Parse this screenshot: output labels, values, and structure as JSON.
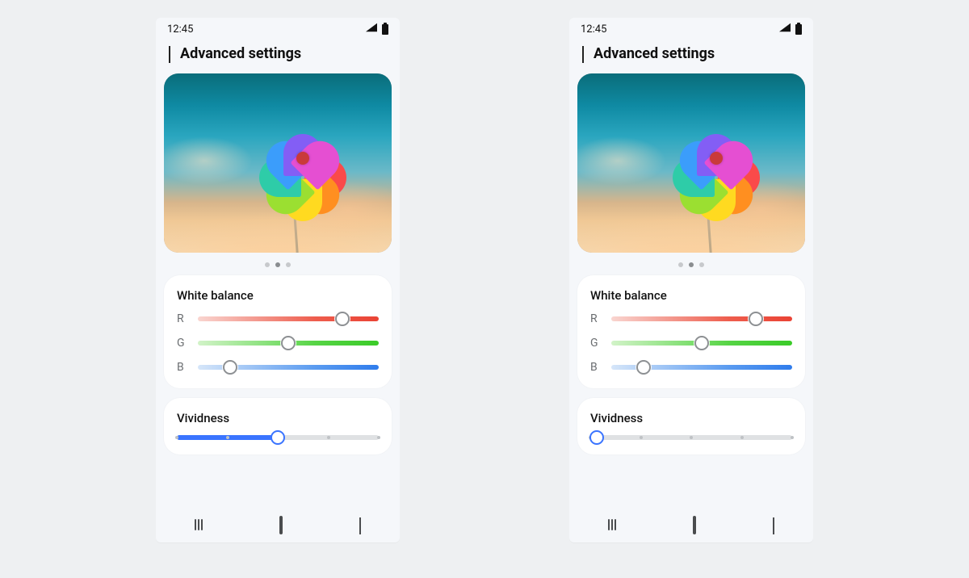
{
  "status": {
    "time": "12:45"
  },
  "header": {
    "title": "Advanced settings"
  },
  "pager": {
    "count": 3,
    "active": 1
  },
  "colors": {
    "accent": "#3a74ff",
    "r": "#ea4335",
    "g": "#3acb28",
    "b": "#2f7cec"
  },
  "pinwheel_colors": [
    "#e24a4a",
    "#f08a2a",
    "#f2cf2e",
    "#97d23b",
    "#36bfa0",
    "#3f94e6",
    "#7b5bde",
    "#d14fc0"
  ],
  "screens": [
    {
      "white_balance": {
        "title": "White balance",
        "r": {
          "label": "R",
          "value": 80
        },
        "g": {
          "label": "G",
          "value": 50
        },
        "b": {
          "label": "B",
          "value": 18
        }
      },
      "vividness": {
        "title": "Vividness",
        "value": 50,
        "ticks": [
          0,
          25,
          50,
          75,
          100
        ]
      }
    },
    {
      "white_balance": {
        "title": "White balance",
        "r": {
          "label": "R",
          "value": 80
        },
        "g": {
          "label": "G",
          "value": 50
        },
        "b": {
          "label": "B",
          "value": 18
        }
      },
      "vividness": {
        "title": "Vividness",
        "value": 3,
        "ticks": [
          0,
          25,
          50,
          75,
          100
        ]
      }
    }
  ]
}
